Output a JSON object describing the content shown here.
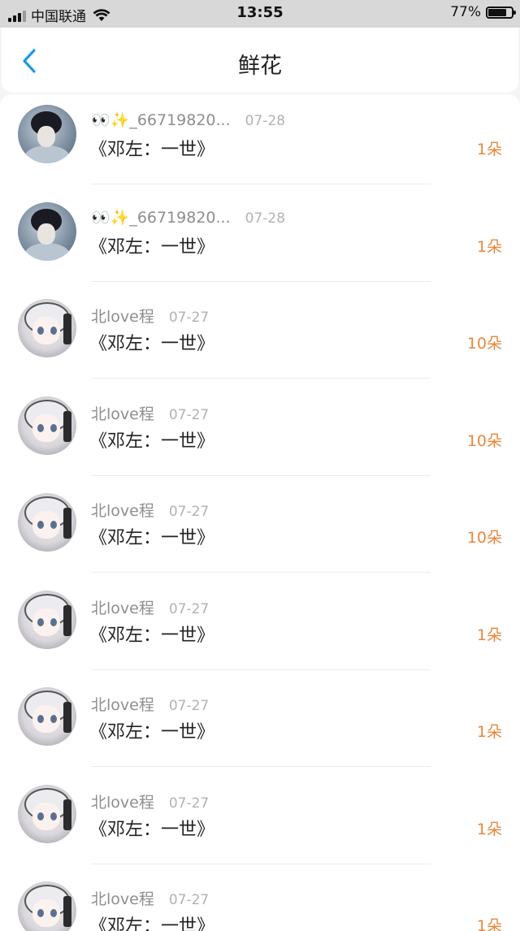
{
  "status_bar": {
    "carrier": "中国联通",
    "time": "13:55",
    "battery_percent": "77%",
    "battery_level": 0.77
  },
  "header": {
    "back_icon": "chevron-left-icon",
    "title": "鲜花"
  },
  "colors": {
    "accent_back": "#1a9be6",
    "count_orange": "#e8873b"
  },
  "items": [
    {
      "name": "👀✨_66719820...",
      "date": "07-28",
      "title": "《邓左：一世》",
      "count": "1朵",
      "avatar": "photo"
    },
    {
      "name": "👀✨_66719820...",
      "date": "07-28",
      "title": "《邓左：一世》",
      "count": "1朵",
      "avatar": "photo"
    },
    {
      "name": "北love程",
      "date": "07-27",
      "title": "《邓左：一世》",
      "count": "10朵",
      "avatar": "anime"
    },
    {
      "name": "北love程",
      "date": "07-27",
      "title": "《邓左：一世》",
      "count": "10朵",
      "avatar": "anime"
    },
    {
      "name": "北love程",
      "date": "07-27",
      "title": "《邓左：一世》",
      "count": "10朵",
      "avatar": "anime"
    },
    {
      "name": "北love程",
      "date": "07-27",
      "title": "《邓左：一世》",
      "count": "1朵",
      "avatar": "anime"
    },
    {
      "name": "北love程",
      "date": "07-27",
      "title": "《邓左：一世》",
      "count": "1朵",
      "avatar": "anime"
    },
    {
      "name": "北love程",
      "date": "07-27",
      "title": "《邓左：一世》",
      "count": "1朵",
      "avatar": "anime"
    },
    {
      "name": "北love程",
      "date": "07-27",
      "title": "《邓左：一世》",
      "count": "1朵",
      "avatar": "anime"
    }
  ]
}
